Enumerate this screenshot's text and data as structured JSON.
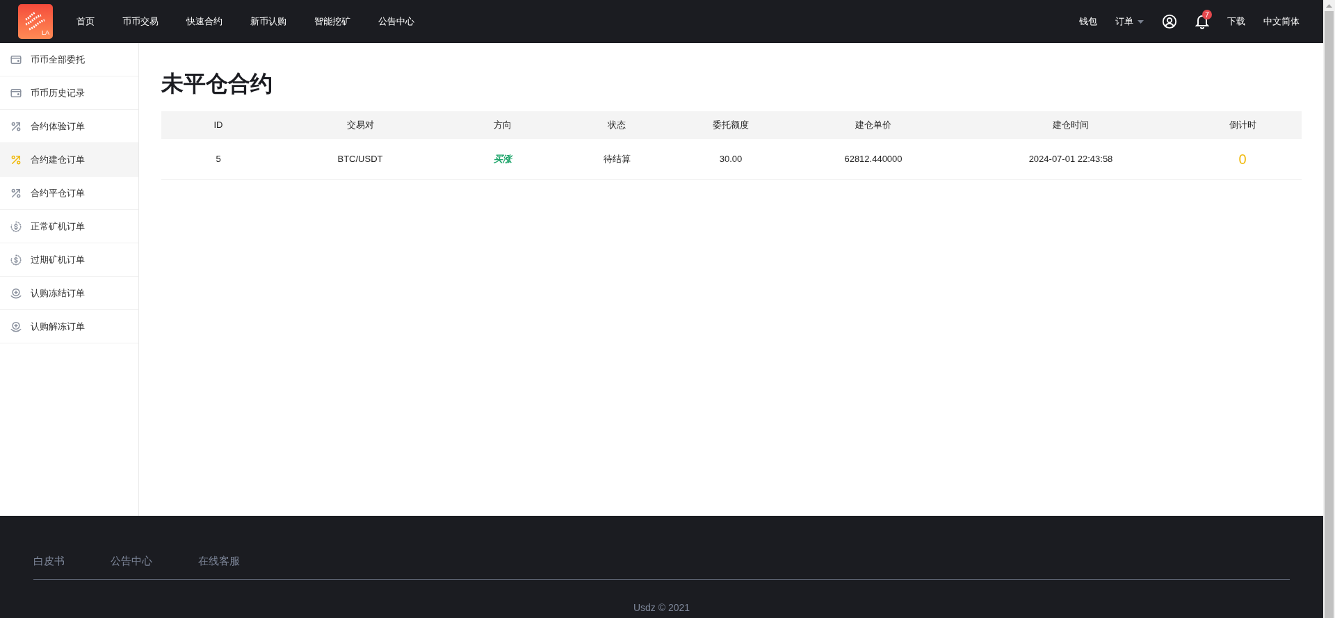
{
  "header": {
    "logo_text": "LA",
    "nav": [
      {
        "label": "首页"
      },
      {
        "label": "币币交易"
      },
      {
        "label": "快速合约"
      },
      {
        "label": "新币认购"
      },
      {
        "label": "智能挖矿"
      },
      {
        "label": "公告中心"
      }
    ],
    "wallet": "钱包",
    "orders": "订单",
    "notification_count": "7",
    "download": "下载",
    "language": "中文简体"
  },
  "sidebar": {
    "items": [
      {
        "label": "币币全部委托",
        "kind": "wallet",
        "selected": false
      },
      {
        "label": "币币历史记录",
        "kind": "wallet",
        "selected": false
      },
      {
        "label": "合约体验订单",
        "kind": "percent",
        "selected": false
      },
      {
        "label": "合约建仓订单",
        "kind": "percent",
        "selected": true
      },
      {
        "label": "合约平仓订单",
        "kind": "percent",
        "selected": false
      },
      {
        "label": "正常矿机订单",
        "kind": "coin",
        "selected": false
      },
      {
        "label": "过期矿机订单",
        "kind": "coin",
        "selected": false
      },
      {
        "label": "认购冻结订单",
        "kind": "hand-coin",
        "selected": false
      },
      {
        "label": "认购解冻订单",
        "kind": "hand-coin",
        "selected": false
      }
    ]
  },
  "page_title": "未平仓合约",
  "table": {
    "columns": [
      "ID",
      "交易对",
      "方向",
      "状态",
      "委托额度",
      "建仓单价",
      "建仓时间",
      "倒计时"
    ],
    "rows": [
      {
        "id": "5",
        "pair": "BTC/USDT",
        "direction": "买涨",
        "status": "待结算",
        "amount": "30.00",
        "price": "62812.440000",
        "time": "2024-07-01 22:43:58",
        "countdown": "0"
      }
    ]
  },
  "footer": {
    "links": [
      "白皮书",
      "公告中心",
      "在线客服"
    ],
    "copyright": "Usdz © 2021"
  }
}
